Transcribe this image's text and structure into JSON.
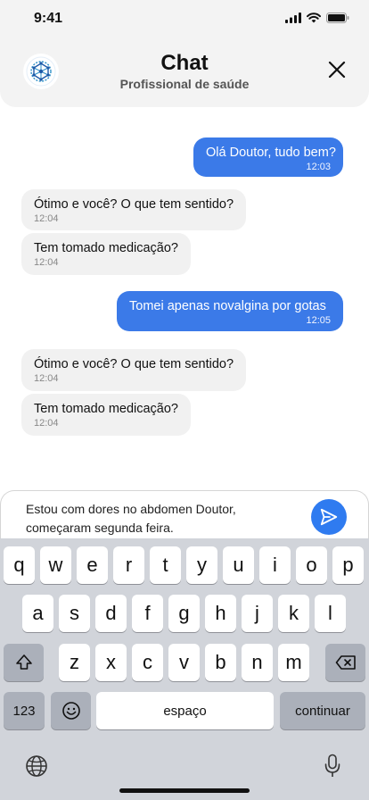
{
  "status": {
    "time": "9:41"
  },
  "header": {
    "title": "Chat",
    "subtitle": "Profissional de saúde"
  },
  "messages": [
    {
      "text": "Olá Doutor, tudo bem?",
      "time": "12:03",
      "direction": "out"
    },
    {
      "text": "Ótimo e você? O que tem sentido?",
      "time": "12:04",
      "direction": "in"
    },
    {
      "text": "Tem tomado medicação?",
      "time": "12:04",
      "direction": "in"
    },
    {
      "text": "Tomei apenas novalgina por gotas",
      "time": "12:05",
      "direction": "out"
    },
    {
      "text": "Ótimo e você? O que tem sentido?",
      "time": "12:04",
      "direction": "in"
    },
    {
      "text": "Tem tomado medicação?",
      "time": "12:04",
      "direction": "in"
    }
  ],
  "composer": {
    "value_line1": "Estou com dores no abdomen Doutor,",
    "value_line2": "começaram segunda feira."
  },
  "keyboard": {
    "row1": [
      "q",
      "w",
      "e",
      "r",
      "t",
      "y",
      "u",
      "i",
      "o",
      "p"
    ],
    "row2": [
      "a",
      "s",
      "d",
      "f",
      "g",
      "h",
      "j",
      "k",
      "l"
    ],
    "row3": [
      "z",
      "x",
      "c",
      "v",
      "b",
      "n",
      "m"
    ],
    "numbers_label": "123",
    "space_label": "espaço",
    "return_label": "continuar"
  },
  "colors": {
    "accent": "#3b7ae8",
    "incoming_bubble": "#f1f1f1",
    "header_bg": "#f3f3f3",
    "keyboard_bg": "#d1d4da"
  }
}
